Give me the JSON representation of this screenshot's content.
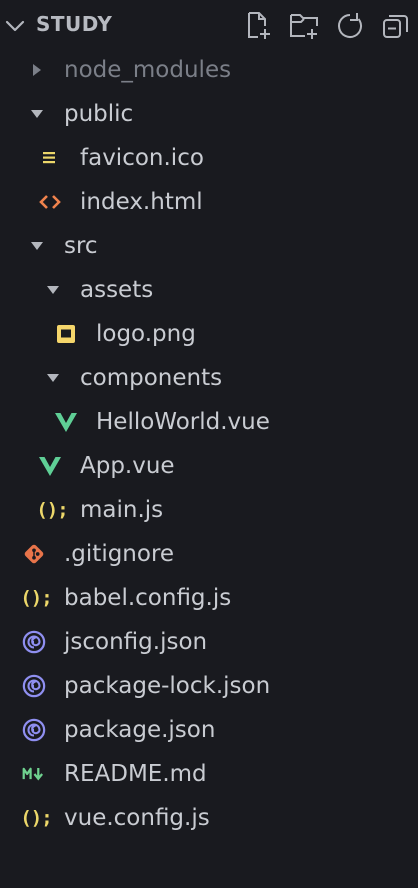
{
  "explorer": {
    "title": "STUDY",
    "actions": [
      {
        "name": "new-file-icon"
      },
      {
        "name": "new-folder-icon"
      },
      {
        "name": "refresh-icon"
      },
      {
        "name": "collapse-all-icon"
      }
    ]
  },
  "tree": [
    {
      "label": "node_modules",
      "type": "folder",
      "expanded": false,
      "depth": 0,
      "dim": true
    },
    {
      "label": "public",
      "type": "folder",
      "expanded": true,
      "depth": 0
    },
    {
      "label": "favicon.ico",
      "type": "ico",
      "depth": 1
    },
    {
      "label": "index.html",
      "type": "html",
      "depth": 1
    },
    {
      "label": "src",
      "type": "folder",
      "expanded": true,
      "depth": 0
    },
    {
      "label": "assets",
      "type": "folder",
      "expanded": true,
      "depth": 1
    },
    {
      "label": "logo.png",
      "type": "png",
      "depth": 2
    },
    {
      "label": "components",
      "type": "folder",
      "expanded": true,
      "depth": 1
    },
    {
      "label": "HelloWorld.vue",
      "type": "vue",
      "depth": 2
    },
    {
      "label": "App.vue",
      "type": "vue",
      "depth": 1
    },
    {
      "label": "main.js",
      "type": "js",
      "depth": 1
    },
    {
      "label": ".gitignore",
      "type": "git",
      "depth": 0
    },
    {
      "label": "babel.config.js",
      "type": "js",
      "depth": 0
    },
    {
      "label": "jsconfig.json",
      "type": "json",
      "depth": 0
    },
    {
      "label": "package-lock.json",
      "type": "json",
      "depth": 0
    },
    {
      "label": "package.json",
      "type": "json",
      "depth": 0
    },
    {
      "label": "README.md",
      "type": "md",
      "depth": 0
    },
    {
      "label": "vue.config.js",
      "type": "js",
      "depth": 0
    }
  ],
  "colors": {
    "background": "#191a1f",
    "text": "#c9ccd2",
    "dim_text": "#7b7f88",
    "icon_gray": "#b3b6bd",
    "js_yellow": "#ecd76a",
    "vue_green": "#5fcf96",
    "html_orange": "#f0834d",
    "git_orange": "#e8744a",
    "json_purple": "#8f8ff0",
    "md_green": "#6fd28f",
    "png_yellow": "#f5d66b"
  }
}
